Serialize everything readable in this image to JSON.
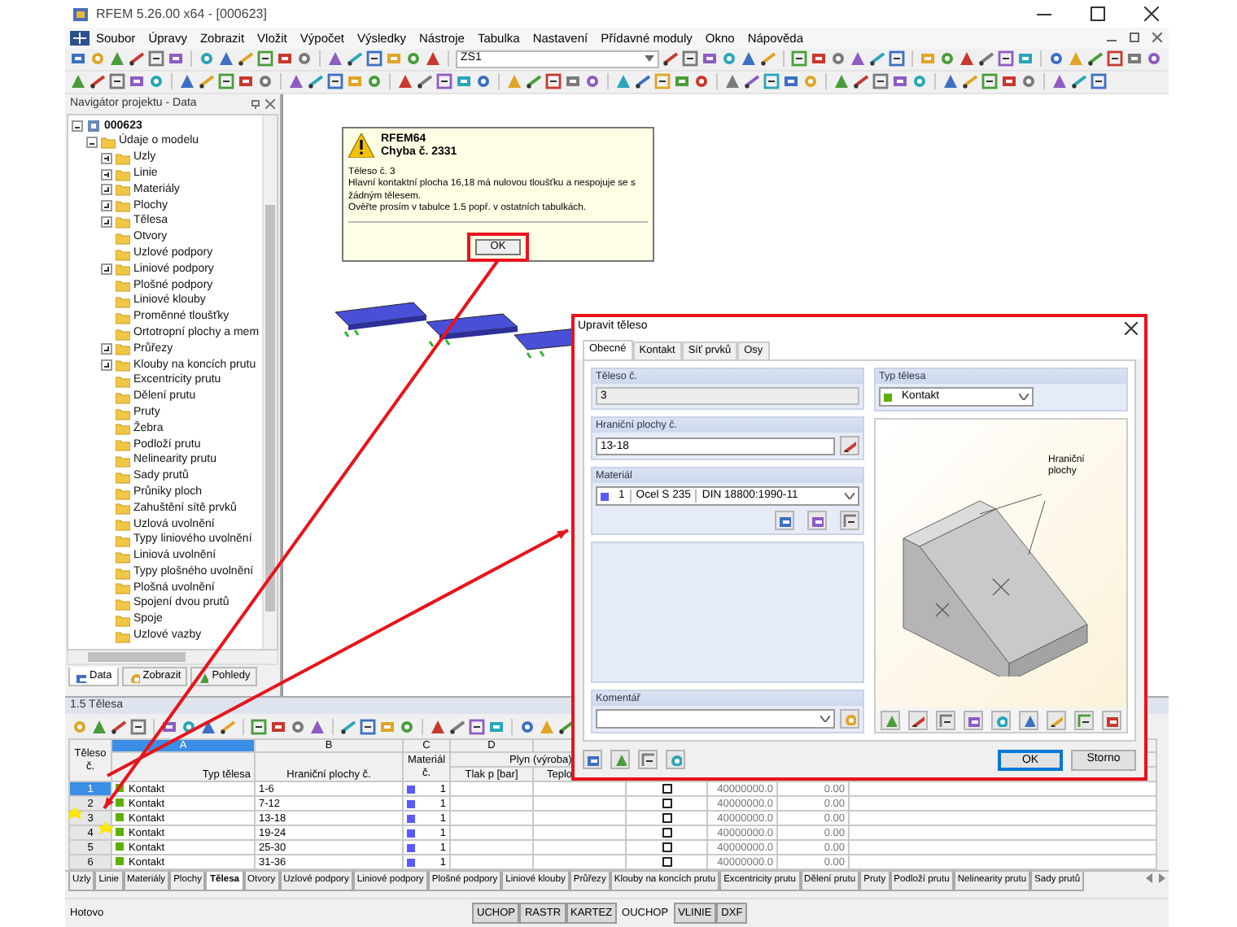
{
  "window": {
    "title": "RFEM 5.26.00 x64 - [000623]"
  },
  "menu": [
    "Soubor",
    "Úpravy",
    "Zobrazit",
    "Vložit",
    "Výpočet",
    "Výsledky",
    "Nástroje",
    "Tabulka",
    "Nastavení",
    "Přídavné moduly",
    "Okno",
    "Nápověda"
  ],
  "toolbar": {
    "load_case": "ZS1"
  },
  "navigator": {
    "title": "Navigátor projektu - Data",
    "tree": [
      {
        "label": "000623",
        "expanded": true,
        "children": [
          {
            "label": "Údaje o modelu",
            "expanded": true,
            "children": [
              {
                "label": "Uzly",
                "expanded": false
              },
              {
                "label": "Linie",
                "expanded": false
              },
              {
                "label": "Materiály",
                "expanded": false
              },
              {
                "label": "Plochy",
                "expanded": false
              },
              {
                "label": "Tělesa",
                "expanded": false
              },
              {
                "label": "Otvory"
              },
              {
                "label": "Uzlové podpory"
              },
              {
                "label": "Liniové podpory",
                "expanded": false
              },
              {
                "label": "Plošné podpory"
              },
              {
                "label": "Liniové klouby"
              },
              {
                "label": "Proměnné tloušťky"
              },
              {
                "label": "Ortotropní plochy a mem"
              },
              {
                "label": "Průřezy",
                "expanded": false
              },
              {
                "label": "Klouby na koncích prutu",
                "expanded": false
              },
              {
                "label": "Excentricity prutu"
              },
              {
                "label": "Dělení prutu"
              },
              {
                "label": "Pruty"
              },
              {
                "label": "Žebra"
              },
              {
                "label": "Podloží prutu"
              },
              {
                "label": "Nelinearity prutu"
              },
              {
                "label": "Sady prutů"
              },
              {
                "label": "Průniky ploch"
              },
              {
                "label": "Zahuštění sítě prvků"
              },
              {
                "label": "Uzlová uvolnění"
              },
              {
                "label": "Typy liniového uvolnění"
              },
              {
                "label": "Liniová uvolnění"
              },
              {
                "label": "Typy plošného uvolnění"
              },
              {
                "label": "Plošná uvolnění"
              },
              {
                "label": "Spojení dvou prutů"
              },
              {
                "label": "Spoje"
              },
              {
                "label": "Uzlové vazby"
              }
            ]
          }
        ]
      }
    ],
    "tabs": [
      {
        "label": "Data",
        "selected": true
      },
      {
        "label": "Zobrazit",
        "selected": false
      },
      {
        "label": "Pohledy",
        "selected": false
      }
    ]
  },
  "error_message": {
    "app": "RFEM64",
    "code": "Chyba č. 2331",
    "lines": [
      "Těleso č. 3",
      "Hlavní kontaktní plocha 16,18 má nulovou tloušťku a nespojuje se s žádným tělesem.",
      "Ověřte prosím v tabulce 1.5 popř. v ostatních tabulkách."
    ],
    "button": "OK"
  },
  "dialog": {
    "title": "Upravit těleso",
    "tabs": [
      {
        "label": "Obecné",
        "selected": true
      },
      {
        "label": "Kontakt",
        "selected": false
      },
      {
        "label": "Síť prvků",
        "selected": false
      },
      {
        "label": "Osy",
        "selected": false
      }
    ],
    "body_no": {
      "label": "Těleso č.",
      "value": "3"
    },
    "body_type": {
      "label": "Typ tělesa",
      "value": "Kontakt"
    },
    "boundary_surfaces": {
      "label": "Hraniční plochy č.",
      "value": "13-18"
    },
    "material": {
      "label": "Materiál",
      "number": "1",
      "name": "Ocel S 235",
      "standard": "DIN 18800:1990-11"
    },
    "comment": {
      "label": "Komentář"
    },
    "preview": {
      "callout": "Hraniční plochy"
    },
    "buttons": [
      {
        "label": "OK",
        "default": true
      },
      {
        "label": "Storno",
        "default": false
      }
    ]
  },
  "table": {
    "title": "1.5 Tělesa",
    "columns": [
      {
        "letter": "A",
        "selected": true
      },
      {
        "letter": "B",
        "selected": false
      },
      {
        "letter": "C",
        "selected": false
      },
      {
        "letter": "D",
        "selected": false
      }
    ],
    "headers": {
      "body_no": "Těleso č.",
      "type": "Typ tělesa",
      "surfaces": "Hraniční plochy č.",
      "material": "Materiál č.",
      "gas": "Plyn (výroba)",
      "pressure": "Tlak p [bar]",
      "temperature": "Teplo"
    },
    "rows": [
      {
        "no": "1",
        "selected": true,
        "type": "Kontakt",
        "surfaces": "1-6",
        "material": "1",
        "column_7_checked": false,
        "column_8": "40000000.0",
        "column_9": "0.00"
      },
      {
        "no": "2",
        "selected": false,
        "type": "Kontakt",
        "surfaces": "7-12",
        "material": "1",
        "column_7_checked": false,
        "column_8": "40000000.0",
        "column_9": "0.00"
      },
      {
        "no": "3",
        "selected": false,
        "type": "Kontakt",
        "surfaces": "13-18",
        "material": "1",
        "column_7_checked": false,
        "column_8": "40000000.0",
        "column_9": "0.00"
      },
      {
        "no": "4",
        "selected": false,
        "type": "Kontakt",
        "surfaces": "19-24",
        "material": "1",
        "column_7_checked": false,
        "column_8": "40000000.0",
        "column_9": "0.00"
      },
      {
        "no": "5",
        "selected": false,
        "type": "Kontakt",
        "surfaces": "25-30",
        "material": "1",
        "column_7_checked": false,
        "column_8": "40000000.0",
        "column_9": "0.00"
      },
      {
        "no": "6",
        "selected": false,
        "type": "Kontakt",
        "surfaces": "31-36",
        "material": "1",
        "column_7_checked": false,
        "column_8": "40000000.0",
        "column_9": "0.00"
      }
    ]
  },
  "sheet_tabs": [
    {
      "label": "Uzly",
      "selected": false
    },
    {
      "label": "Linie",
      "selected": false
    },
    {
      "label": "Materiály",
      "selected": false
    },
    {
      "label": "Plochy",
      "selected": false
    },
    {
      "label": "Tělesa",
      "selected": true
    },
    {
      "label": "Otvory",
      "selected": false
    },
    {
      "label": "Uzlové podpory",
      "selected": false
    },
    {
      "label": "Liniové podpory",
      "selected": false
    },
    {
      "label": "Plošné podpory",
      "selected": false
    },
    {
      "label": "Liniové klouby",
      "selected": false
    },
    {
      "label": "Průřezy",
      "selected": false
    },
    {
      "label": "Klouby na koncích prutu",
      "selected": false
    },
    {
      "label": "Excentricity prutu",
      "selected": false
    },
    {
      "label": "Dělení prutu",
      "selected": false
    },
    {
      "label": "Pruty",
      "selected": false
    },
    {
      "label": "Podloží prutu",
      "selected": false
    },
    {
      "label": "Nelinearity prutu",
      "selected": false
    },
    {
      "label": "Sady prutů",
      "selected": false
    }
  ],
  "status_bar": {
    "text": "Hotovo",
    "toggles": [
      {
        "label": "UCHOP",
        "on": true
      },
      {
        "label": "RASTR",
        "on": true
      },
      {
        "label": "KARTEZ",
        "on": true
      },
      {
        "label": "OUCHOP",
        "on": false
      },
      {
        "label": "VLINIE",
        "on": true
      },
      {
        "label": "DXF",
        "on": true
      }
    ]
  }
}
